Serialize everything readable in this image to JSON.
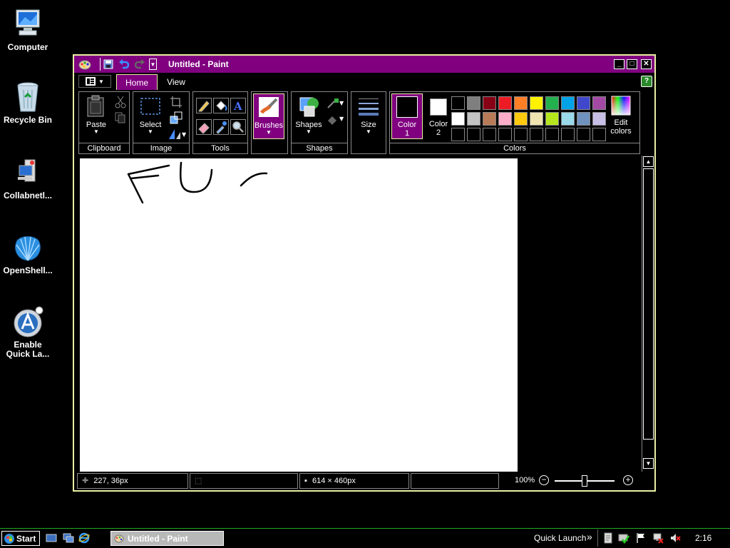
{
  "desktop": {
    "icons": [
      {
        "label": "Computer",
        "icon": "computer-icon"
      },
      {
        "label": "Recycle Bin",
        "icon": "recycle-bin-icon"
      },
      {
        "label": "Collabnetl...",
        "icon": "collabnet-icon"
      },
      {
        "label": "OpenShell...",
        "icon": "openshell-icon"
      },
      {
        "label": "Enable\nQuick La...",
        "icon": "quick-launch-icon"
      }
    ]
  },
  "window": {
    "title": "Untitled - Paint",
    "controls": {
      "minimize": "_",
      "maximize": "□",
      "close": "✕"
    },
    "help": "?"
  },
  "tabs": [
    {
      "label": "Home",
      "active": true
    },
    {
      "label": "View",
      "active": false
    }
  ],
  "ribbon": {
    "groups": {
      "clipboard": "Clipboard",
      "image": "Image",
      "tools": "Tools",
      "shapes": "Shapes",
      "colors": "Colors"
    },
    "buttons": {
      "paste": "Paste",
      "select": "Select",
      "brushes": "Brushes",
      "shapes": "Shapes",
      "size": "Size",
      "color1_a": "Color",
      "color1_b": "1",
      "color2_a": "Color",
      "color2_b": "2",
      "edit_colors_a": "Edit",
      "edit_colors_b": "colors"
    },
    "color1": "#000000",
    "color2": "#ffffff",
    "palette_row1": [
      "#000000",
      "#7f7f7f",
      "#880015",
      "#ed1c24",
      "#ff7f27",
      "#fff200",
      "#22b14c",
      "#00a2e8",
      "#3f48cc",
      "#a349a4"
    ],
    "palette_row2": [
      "#ffffff",
      "#c3c3c3",
      "#b97a57",
      "#ffaec9",
      "#ffc90e",
      "#efe4b0",
      "#b5e61d",
      "#99d9ea",
      "#7092be",
      "#c8bfe7"
    ],
    "accent": "#800080"
  },
  "status": {
    "cursor_pos": "227, 36px",
    "canvas_size": "614 × 460px",
    "zoom": "100%",
    "zoom_fraction": 0.5
  },
  "taskbar": {
    "start": "Start",
    "task": "Untitled - Paint",
    "quick_launch": "Quick Launch",
    "chevron": "»",
    "clock": "2:16"
  }
}
